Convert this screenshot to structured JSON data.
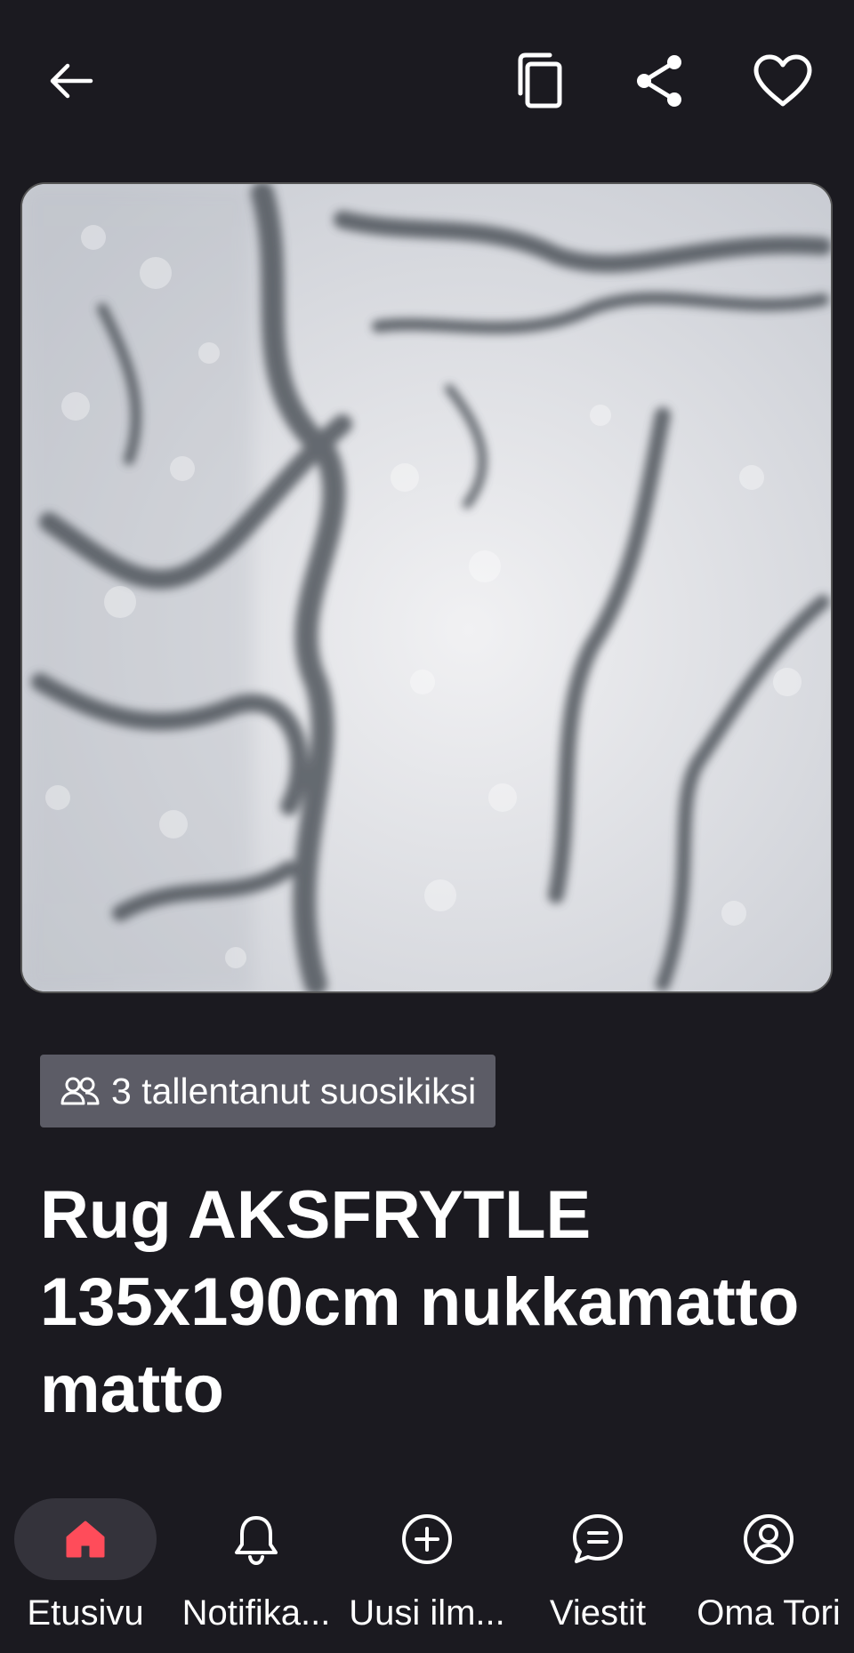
{
  "header": {
    "back_icon": "arrow-left-icon",
    "copy_icon": "copy-icon",
    "share_icon": "share-icon",
    "favorite_icon": "heart-outline-icon"
  },
  "listing": {
    "photo_description_icon": "rug-photo",
    "saved_badge": {
      "icon": "users-icon",
      "text": "3 tallentanut suosikiksi"
    },
    "title": "Rug AKSFRYTLE 135x190cm nukkamatto matto"
  },
  "bottom_nav": {
    "items": [
      {
        "label": "Etusivu",
        "icon": "home-icon",
        "active": true
      },
      {
        "label": "Notifika...",
        "icon": "bell-icon",
        "active": false
      },
      {
        "label": "Uusi ilm...",
        "icon": "plus-circle-icon",
        "active": false
      },
      {
        "label": "Viestit",
        "icon": "chat-icon",
        "active": false
      },
      {
        "label": "Oma Tori",
        "icon": "user-circle-icon",
        "active": false
      }
    ]
  },
  "colors": {
    "background": "#1b1a20",
    "badge_bg": "#5c5c66",
    "active_pill": "#34333b",
    "accent_red": "#ff4c5a",
    "text": "#ffffff"
  }
}
